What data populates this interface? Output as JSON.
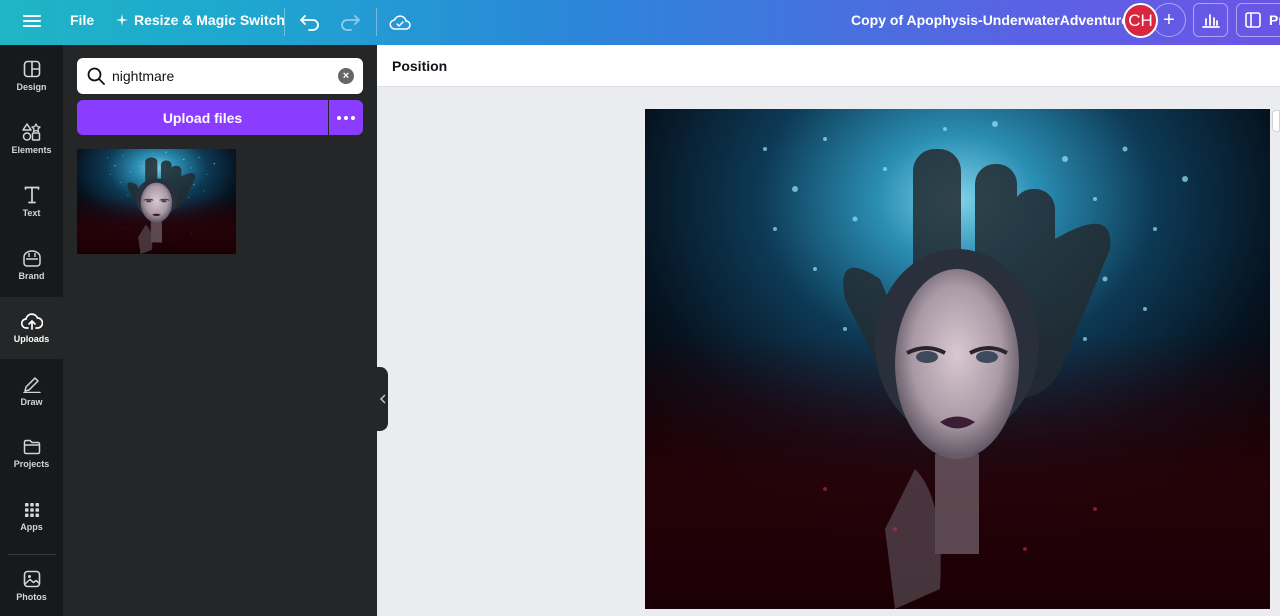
{
  "topbar": {
    "file_label": "File",
    "resize_label": "Resize & Magic Switch",
    "design_title": "Copy of Apophysis-UnderwaterAdventure",
    "avatar_initials": "CH",
    "present_label": "Pr",
    "colors": {
      "gradient_start": "#1fb5c5",
      "gradient_end": "#6b55e6",
      "avatar": "#d7263d"
    }
  },
  "rail": {
    "items": [
      {
        "label": "Design",
        "icon": "layout-icon"
      },
      {
        "label": "Elements",
        "icon": "shapes-icon"
      },
      {
        "label": "Text",
        "icon": "text-icon"
      },
      {
        "label": "Brand",
        "icon": "brand-icon"
      },
      {
        "label": "Uploads",
        "icon": "cloud-upload-icon",
        "active": true
      },
      {
        "label": "Draw",
        "icon": "pen-icon"
      },
      {
        "label": "Projects",
        "icon": "folder-icon"
      },
      {
        "label": "Apps",
        "icon": "grid-icon"
      },
      {
        "label": "Photos",
        "icon": "image-icon"
      }
    ]
  },
  "panel": {
    "search_value": "nightmare",
    "upload_label": "Upload files",
    "accent": "#8b3dff"
  },
  "context_toolbar": {
    "position_label": "Position"
  }
}
